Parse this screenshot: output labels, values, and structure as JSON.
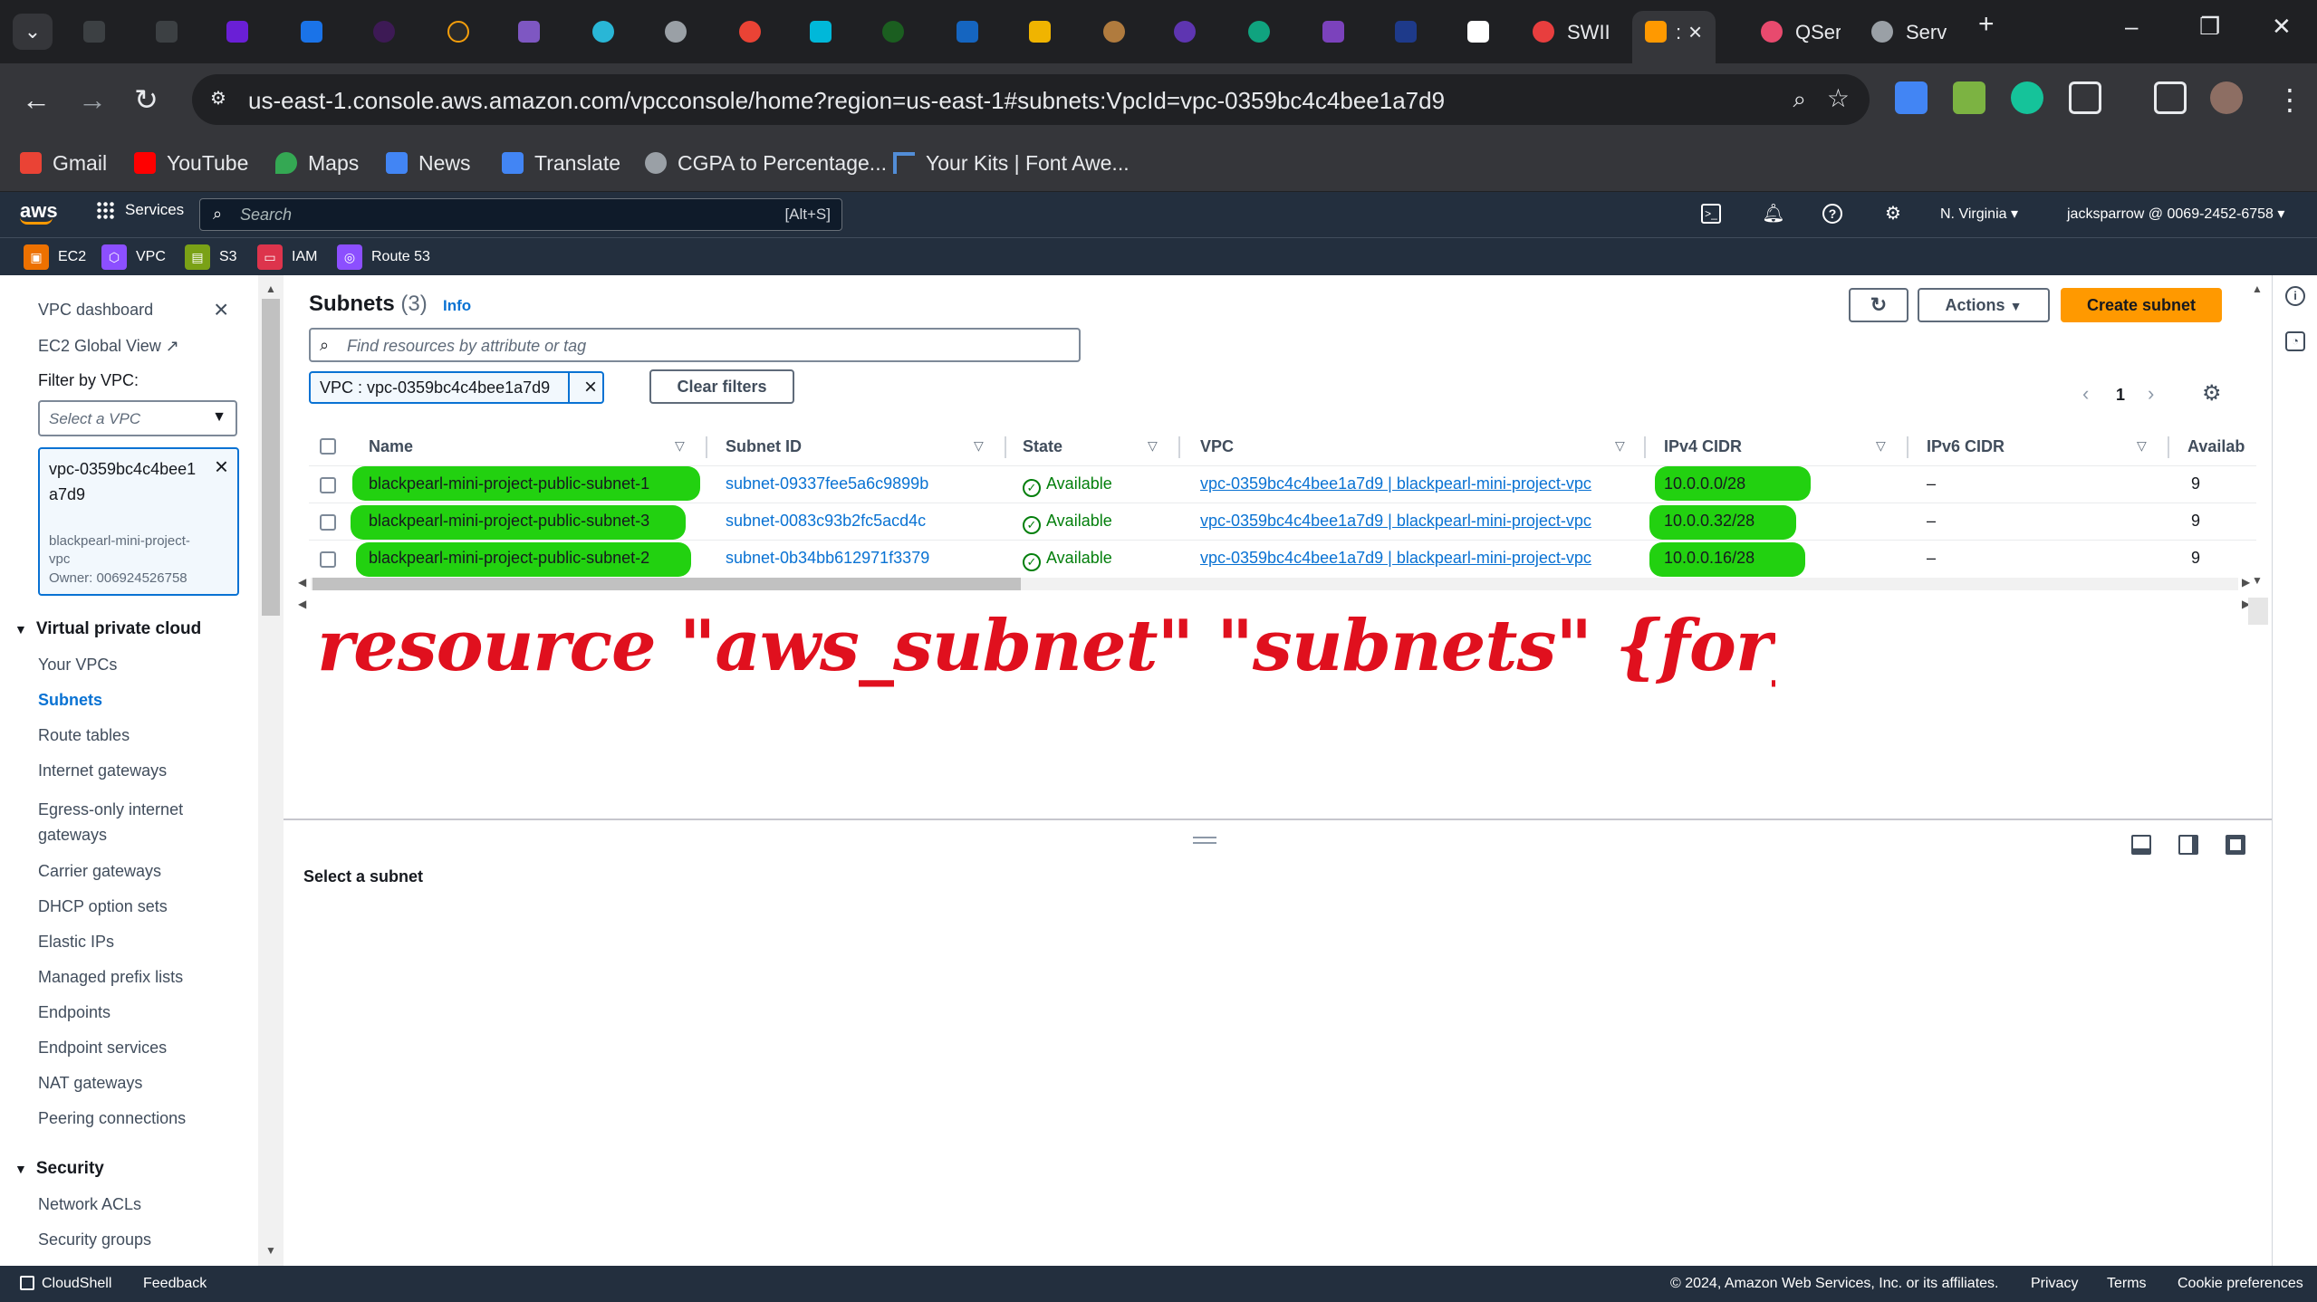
{
  "browser": {
    "tabs": [
      {
        "title": "SWII",
        "icon": "red-circle-icon",
        "color": "#e83e3e"
      },
      {
        "title": ":",
        "icon": "aws-cube-icon",
        "color": "#ff9900",
        "active": true
      },
      {
        "title": "QSer",
        "icon": "chat-icon",
        "color": "#e84a6e"
      },
      {
        "title": "Serv",
        "icon": "globe-icon",
        "color": "#9aa0a6"
      }
    ],
    "url": "us-east-1.console.aws.amazon.com/vpcconsole/home?region=us-east-1#subnets:VpcId=vpc-0359bc4c4bee1a7d9",
    "bookmarks": [
      {
        "label": "Gmail",
        "color": "#ea4335"
      },
      {
        "label": "YouTube",
        "color": "#ff0000"
      },
      {
        "label": "Maps",
        "color": "#34a853"
      },
      {
        "label": "News",
        "color": "#4285f4"
      },
      {
        "label": "Translate",
        "color": "#4285f4"
      },
      {
        "label": "CGPA to Percentage...",
        "color": "#9aa0a6"
      },
      {
        "label": "Your Kits | Font Awe...",
        "color": "#528dd7"
      }
    ]
  },
  "aws": {
    "services_label": "Services",
    "search_placeholder": "Search",
    "search_shortcut": "[Alt+S]",
    "region": "N. Virginia",
    "account": "jacksparrow @ 0069-2452-6758",
    "favorites": [
      {
        "label": "EC2",
        "color": "#ed7100"
      },
      {
        "label": "VPC",
        "color": "#8c4fff"
      },
      {
        "label": "S3",
        "color": "#7aa116"
      },
      {
        "label": "IAM",
        "color": "#dd344c"
      },
      {
        "label": "Route 53",
        "color": "#8c4fff"
      }
    ]
  },
  "leftnav": {
    "vpc_dashboard": "VPC dashboard",
    "ec2_global_view": "EC2 Global View",
    "filter_label": "Filter by VPC:",
    "select_placeholder": "Select a VPC",
    "selected_vpc_id": "vpc-0359bc4c4bee1a7d9",
    "selected_vpc_name": "blackpearl-mini-project-vpc",
    "selected_vpc_owner": "Owner: 006924526758",
    "section_vpc": "Virtual private cloud",
    "items": [
      "Your VPCs",
      "Subnets",
      "Route tables",
      "Internet gateways",
      "Egress-only internet gateways",
      "Carrier gateways",
      "DHCP option sets",
      "Elastic IPs",
      "Managed prefix lists",
      "Endpoints",
      "Endpoint services",
      "NAT gateways",
      "Peering connections"
    ],
    "active_item": "Subnets",
    "section_security": "Security",
    "security_items": [
      "Network ACLs",
      "Security groups"
    ]
  },
  "main": {
    "title": "Subnets",
    "count": "(3)",
    "info": "Info",
    "actions_label": "Actions",
    "create_label": "Create subnet",
    "filter_placeholder": "Find resources by attribute or tag",
    "filter_token": "VPC : vpc-0359bc4c4bee1a7d9",
    "clear_filters": "Clear filters",
    "page": "1",
    "columns": [
      "Name",
      "Subnet ID",
      "State",
      "VPC",
      "IPv4 CIDR",
      "IPv6 CIDR",
      "Availab"
    ],
    "rows": [
      {
        "name": "blackpearl-mini-project-public-subnet-1",
        "subnet_id": "subnet-09337fee5a6c9899b",
        "state": "Available",
        "vpc": "vpc-0359bc4c4bee1a7d9 | blackpearl-mini-project-vpc",
        "ipv4": "10.0.0.0/28",
        "ipv6": "–",
        "avail": "9"
      },
      {
        "name": "blackpearl-mini-project-public-subnet-3",
        "subnet_id": "subnet-0083c93b2fc5acd4c",
        "state": "Available",
        "vpc": "vpc-0359bc4c4bee1a7d9 | blackpearl-mini-project-vpc",
        "ipv4": "10.0.0.32/28",
        "ipv6": "–",
        "avail": "9"
      },
      {
        "name": "blackpearl-mini-project-public-subnet-2",
        "subnet_id": "subnet-0b34bb612971f3379",
        "state": "Available",
        "vpc": "vpc-0359bc4c4bee1a7d9 | blackpearl-mini-project-vpc",
        "ipv4": "10.0.0.16/28",
        "ipv6": "–",
        "avail": "9"
      }
    ],
    "annotation": "resource \"aws_subnet\" \"subnets\" {for_each={}}",
    "highlight_color": "#22d110",
    "annotation_color": "#e0101e"
  },
  "split_panel": {
    "title": "Select a subnet"
  },
  "footer": {
    "cloudshell": "CloudShell",
    "feedback": "Feedback",
    "copyright": "© 2024, Amazon Web Services, Inc. or its affiliates.",
    "privacy": "Privacy",
    "terms": "Terms",
    "cookies": "Cookie preferences"
  }
}
